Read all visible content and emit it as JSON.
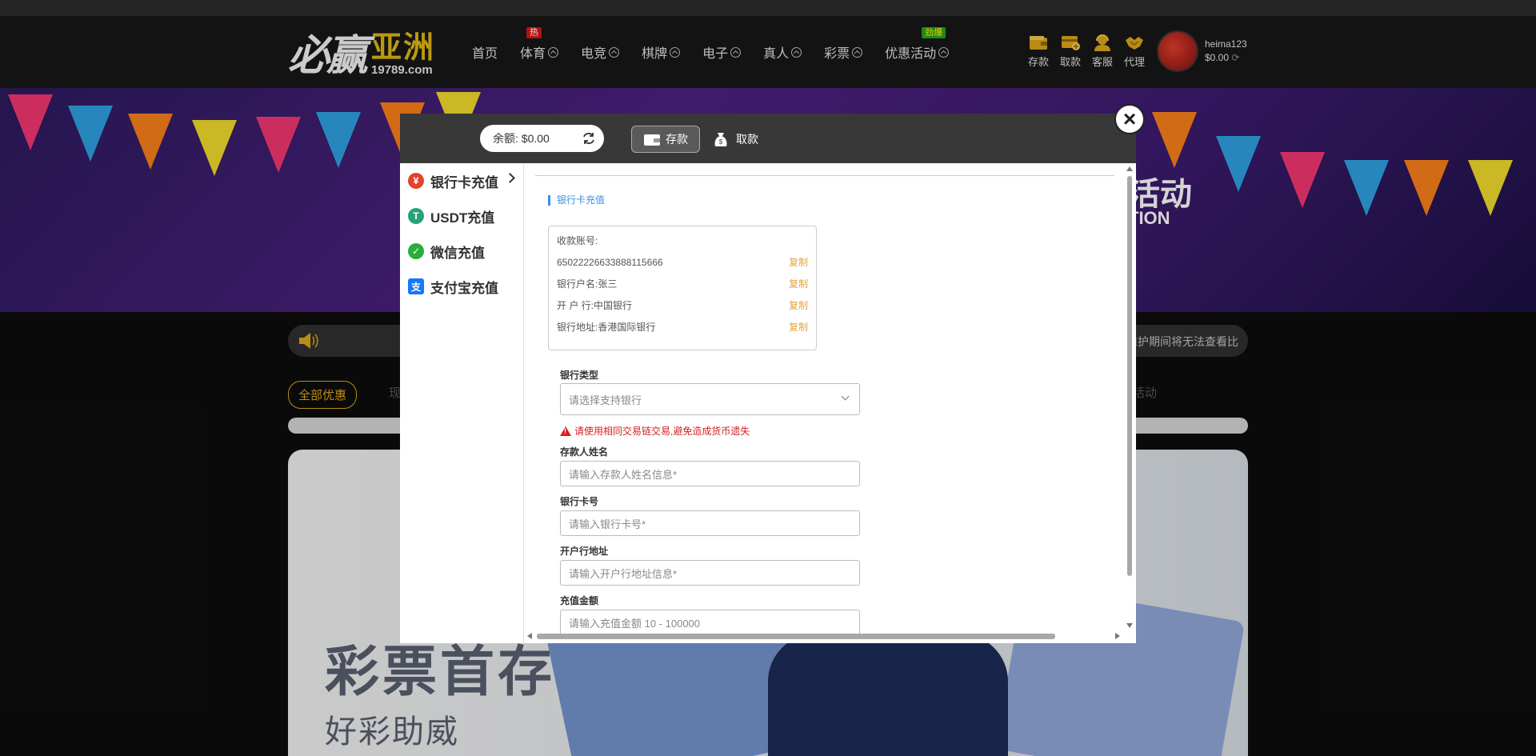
{
  "header": {
    "logo": {
      "cn": "必赢",
      "region": "亚洲",
      "url": "19789.com"
    },
    "nav": [
      {
        "label": "首页",
        "has_chevron": false
      },
      {
        "label": "体育",
        "has_chevron": true,
        "tag": "热"
      },
      {
        "label": "电竞",
        "has_chevron": true
      },
      {
        "label": "棋牌",
        "has_chevron": true
      },
      {
        "label": "电子",
        "has_chevron": true
      },
      {
        "label": "真人",
        "has_chevron": true
      },
      {
        "label": "彩票",
        "has_chevron": true
      },
      {
        "label": "优惠活动",
        "has_chevron": true,
        "tag": "劲爆"
      }
    ],
    "quick_actions": [
      {
        "label": "存款",
        "icon": "wallet-icon"
      },
      {
        "label": "取款",
        "icon": "withdraw-card-icon"
      },
      {
        "label": "客服",
        "icon": "support-agent-icon"
      },
      {
        "label": "代理",
        "icon": "handshake-icon"
      }
    ],
    "user": {
      "username": "heima123",
      "balance": "$0.00"
    }
  },
  "banner": {
    "text_cn": "活动",
    "text_en": "TION"
  },
  "notice": {
    "text": "维护期间将无法查看比"
  },
  "promo_tabs": {
    "active": "全部优惠",
    "partial_left": "现",
    "partial_right": "活动"
  },
  "promo_card": {
    "title": "彩票首存",
    "subtitle": "好彩助威"
  },
  "modal": {
    "balance_label": "余额:",
    "balance_value": "$0.00",
    "tabs": [
      {
        "label": "存款",
        "active": true
      },
      {
        "label": "取款",
        "active": false
      }
    ],
    "close_symbol": "×",
    "side_menu": [
      {
        "label": "银行卡充值",
        "active": true,
        "icon": "bank-card-icon",
        "color": "#e2452b"
      },
      {
        "label": "USDT充值",
        "active": false,
        "icon": "tether-icon",
        "color": "#26a17b"
      },
      {
        "label": "微信充值",
        "active": false,
        "icon": "wechat-icon",
        "color": "#2aae3b"
      },
      {
        "label": "支付宝充值",
        "active": false,
        "icon": "alipay-icon",
        "color": "#1677ff"
      }
    ],
    "section_title": "银行卡充值",
    "account": {
      "header": "收款账号:",
      "number": "65022226633888115666",
      "holder": "银行户名:张三",
      "bank": "开 户 行:中国银行",
      "address": "银行地址:香港国际银行",
      "copy_label": "复制"
    },
    "form": {
      "bank_type_label": "银行类型",
      "bank_type_placeholder": "请选择支持银行",
      "warning": "请使用相同交易链交易,避免造成货币遗失",
      "name_label": "存款人姓名",
      "name_placeholder": "请输入存款人姓名信息*",
      "card_label": "银行卡号",
      "card_placeholder": "请输入银行卡号*",
      "branch_label": "开户行地址",
      "branch_placeholder": "请输入开户行地址信息*",
      "amount_label": "充值金额",
      "amount_placeholder": "请输入充值金额 10 - 100000"
    }
  }
}
